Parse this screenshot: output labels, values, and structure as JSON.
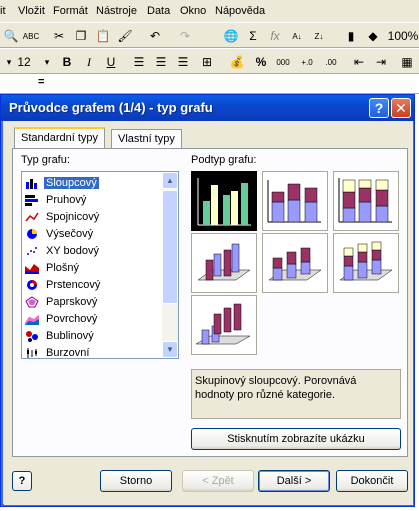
{
  "menubar": {
    "items": [
      "it",
      "Vložit",
      "Formát",
      "Nástroje",
      "Data",
      "Okno",
      "Nápověda"
    ]
  },
  "toolbar": {
    "zoom": "100%",
    "font_size": "12"
  },
  "dialog": {
    "title": "Průvodce grafem (1/4) - typ grafu",
    "help_glyph": "?",
    "close_glyph": "✕",
    "tabs": [
      "Standardní typy",
      "Vlastní typy"
    ],
    "chart_type_label": "Typ grafu:",
    "subtype_label": "Podtyp grafu:",
    "chart_types": [
      {
        "label": "Sloupcový",
        "icon": "column-chart-icon",
        "selected": true
      },
      {
        "label": "Pruhový",
        "icon": "bar-chart-icon"
      },
      {
        "label": "Spojnicový",
        "icon": "line-chart-icon"
      },
      {
        "label": "Výsečový",
        "icon": "pie-chart-icon"
      },
      {
        "label": "XY bodový",
        "icon": "scatter-chart-icon"
      },
      {
        "label": "Plošný",
        "icon": "area-chart-icon"
      },
      {
        "label": "Prstencový",
        "icon": "doughnut-chart-icon"
      },
      {
        "label": "Paprskový",
        "icon": "radar-chart-icon"
      },
      {
        "label": "Povrchový",
        "icon": "surface-chart-icon"
      },
      {
        "label": "Bublinový",
        "icon": "bubble-chart-icon"
      },
      {
        "label": "Burzovní",
        "icon": "stock-chart-icon"
      }
    ],
    "description": "Skupinový sloupcový. Porovnává hodnoty pro různé kategorie.",
    "preview_button": "Stisknutím zobrazíte ukázku",
    "buttons": {
      "cancel": "Storno",
      "back": "< Zpět",
      "next": "Další >",
      "finish": "Dokončit"
    },
    "colors": {
      "bar_blue": "#9999ff",
      "bar_purple": "#993366",
      "bar_cream": "#ffffcc",
      "selected_bg": "#000000",
      "selected_bar": "#66cc99"
    }
  }
}
